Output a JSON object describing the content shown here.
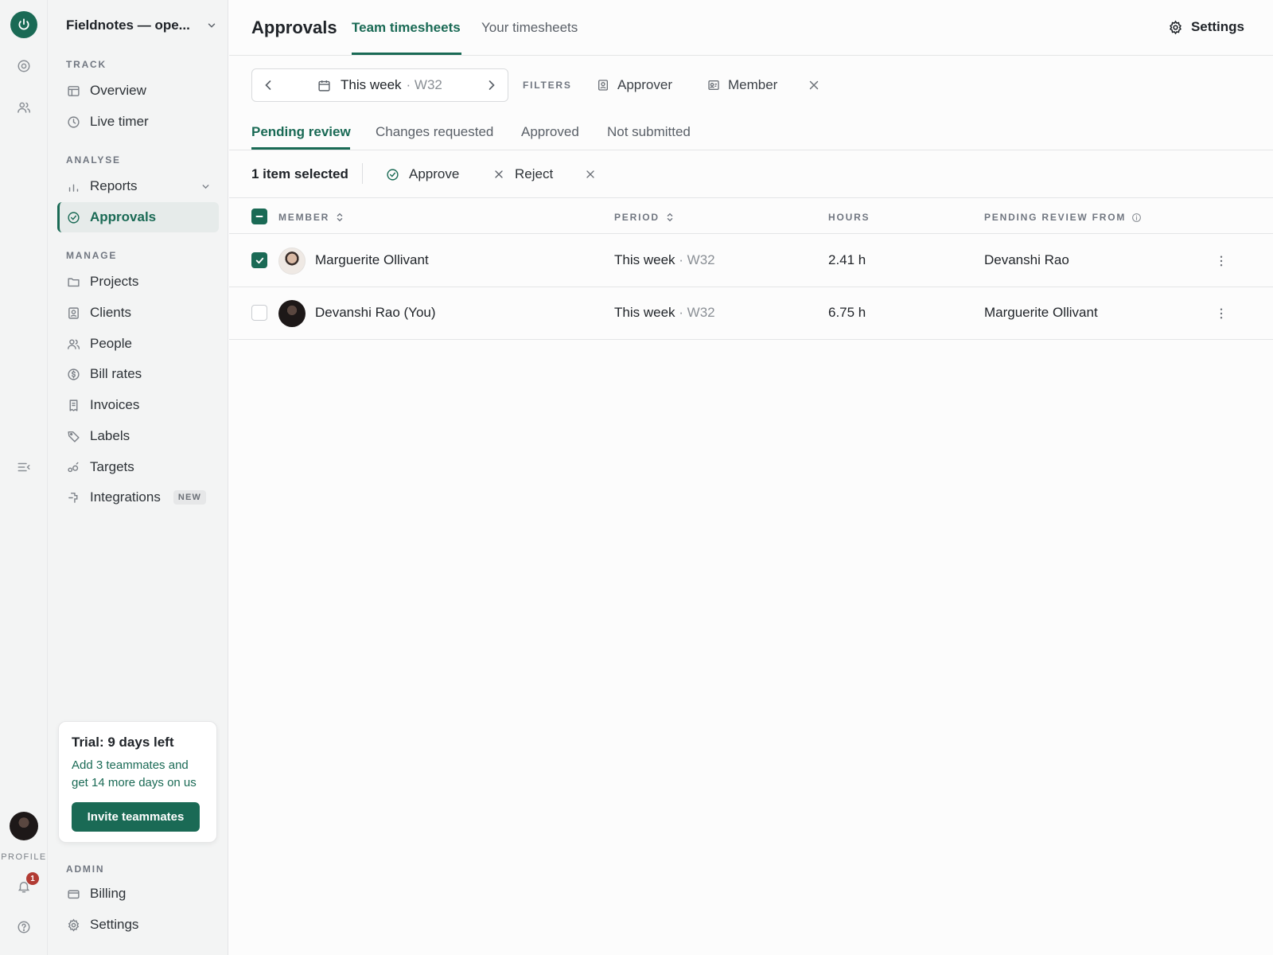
{
  "rail": {
    "profile_label": "PROFILE",
    "notification_count": "1",
    "accent": "#1a6a55"
  },
  "workspace": {
    "name": "Fieldnotes — ope..."
  },
  "sidebar": {
    "sections": {
      "track": "TRACK",
      "analyse": "ANALYSE",
      "manage": "MANAGE",
      "admin": "ADMIN"
    },
    "items": {
      "overview": "Overview",
      "live_timer": "Live timer",
      "reports": "Reports",
      "approvals": "Approvals",
      "projects": "Projects",
      "clients": "Clients",
      "people": "People",
      "bill_rates": "Bill rates",
      "invoices": "Invoices",
      "labels": "Labels",
      "targets": "Targets",
      "integrations": "Integrations",
      "billing": "Billing",
      "settings": "Settings"
    },
    "new_badge": "NEW",
    "trial": {
      "title": "Trial: 9 days left",
      "description": "Add 3 teammates and get 14 more days on us",
      "button": "Invite teammates"
    }
  },
  "header": {
    "title": "Approvals",
    "tabs": [
      "Team timesheets",
      "Your timesheets"
    ],
    "settings_label": "Settings"
  },
  "toolbar": {
    "period": "This week",
    "period_week": "· W32",
    "filters_label": "FILTERS",
    "filter_chips": [
      "Approver",
      "Member"
    ]
  },
  "subtabs": [
    "Pending review",
    "Changes requested",
    "Approved",
    "Not submitted"
  ],
  "bulk": {
    "selected_text": "1 item selected",
    "approve": "Approve",
    "reject": "Reject"
  },
  "table": {
    "columns": {
      "member": "MEMBER",
      "period": "PERIOD",
      "hours": "HOURS",
      "pending_from": "PENDING REVIEW FROM"
    },
    "rows": [
      {
        "member": "Marguerite Ollivant",
        "period": "This week",
        "week": "· W32",
        "hours": "2.41 h",
        "pending_from": "Devanshi Rao",
        "selected": true
      },
      {
        "member": "Devanshi Rao (You)",
        "period": "This week",
        "week": "· W32",
        "hours": "6.75 h",
        "pending_from": "Marguerite Ollivant",
        "selected": false
      }
    ]
  }
}
